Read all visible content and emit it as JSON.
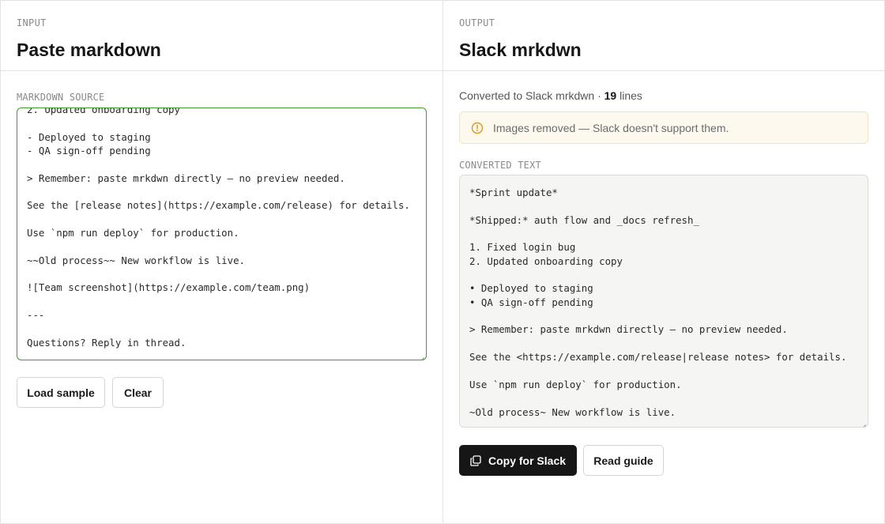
{
  "input": {
    "eyebrow": "INPUT",
    "title": "Paste markdown",
    "field_label": "MARKDOWN SOURCE",
    "source_lines": [
      "2. Updated onboarding copy",
      "",
      "- Deployed to staging",
      "- QA sign-off pending",
      "",
      "> Remember: paste mrkdwn directly — no preview needed.",
      "",
      "See the [release notes](https://example.com/release) for details.",
      "",
      "Use `npm run deploy` for production.",
      "",
      "~~Old process~~ New workflow is live.",
      "",
      "![Team screenshot](https://example.com/team.png)",
      "",
      "---",
      "",
      "Questions? Reply in thread."
    ],
    "load_sample_label": "Load sample",
    "clear_label": "Clear"
  },
  "output": {
    "eyebrow": "OUTPUT",
    "title": "Slack mrkdwn",
    "status_prefix": "Converted to Slack mrkdwn · ",
    "line_count": "19",
    "status_suffix": " lines",
    "notice": "Images removed — Slack doesn't support them.",
    "field_label": "CONVERTED TEXT",
    "converted_lines": [
      "*Sprint update*",
      "",
      "*Shipped:* auth flow and _docs refresh_",
      "",
      "1. Fixed login bug",
      "2. Updated onboarding copy",
      "",
      "• Deployed to staging",
      "• QA sign-off pending",
      "",
      "> Remember: paste mrkdwn directly — no preview needed.",
      "",
      "See the <https://example.com/release|release notes> for details.",
      "",
      "Use `npm run deploy` for production.",
      "",
      "~Old process~ New workflow is live."
    ],
    "copy_label": "Copy for Slack",
    "guide_label": "Read guide"
  },
  "icons": {
    "notice": "info-circle-icon",
    "copy": "copy-icon"
  },
  "colors": {
    "focus_border": "#3f9d2b",
    "notice_bg": "#fdf9ee",
    "notice_icon": "#d99a1e",
    "primary_button": "#161616"
  }
}
